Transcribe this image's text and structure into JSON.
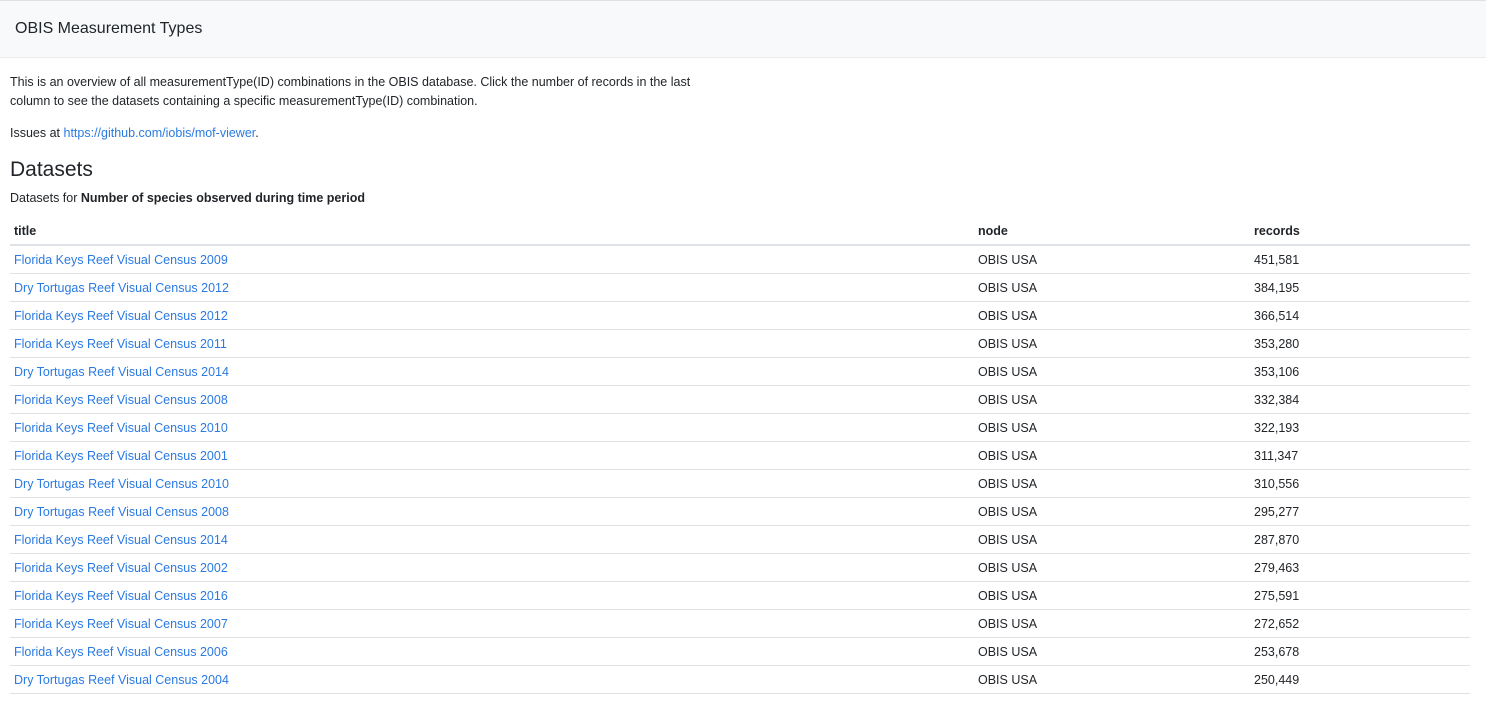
{
  "navbar": {
    "brand": "OBIS Measurement Types"
  },
  "intro": {
    "text": "This is an overview of all measurementType(ID) combinations in the OBIS database. Click the number of records in the last column to see the datasets containing a specific measurementType(ID) combination.",
    "issues_prefix": "Issues at ",
    "issues_link": "https://github.com/iobis/mof-viewer",
    "issues_suffix": "."
  },
  "datasets": {
    "heading": "Datasets",
    "subtitle_prefix": "Datasets for ",
    "subtitle_bold": "Number of species observed during time period",
    "columns": [
      "title",
      "node",
      "records"
    ],
    "rows": [
      {
        "title": "Florida Keys Reef Visual Census 2009",
        "node": "OBIS USA",
        "records": "451,581"
      },
      {
        "title": "Dry Tortugas Reef Visual Census 2012",
        "node": "OBIS USA",
        "records": "384,195"
      },
      {
        "title": "Florida Keys Reef Visual Census 2012",
        "node": "OBIS USA",
        "records": "366,514"
      },
      {
        "title": "Florida Keys Reef Visual Census 2011",
        "node": "OBIS USA",
        "records": "353,280"
      },
      {
        "title": "Dry Tortugas Reef Visual Census 2014",
        "node": "OBIS USA",
        "records": "353,106"
      },
      {
        "title": "Florida Keys Reef Visual Census 2008",
        "node": "OBIS USA",
        "records": "332,384"
      },
      {
        "title": "Florida Keys Reef Visual Census 2010",
        "node": "OBIS USA",
        "records": "322,193"
      },
      {
        "title": "Florida Keys Reef Visual Census 2001",
        "node": "OBIS USA",
        "records": "311,347"
      },
      {
        "title": "Dry Tortugas Reef Visual Census 2010",
        "node": "OBIS USA",
        "records": "310,556"
      },
      {
        "title": "Dry Tortugas Reef Visual Census 2008",
        "node": "OBIS USA",
        "records": "295,277"
      },
      {
        "title": "Florida Keys Reef Visual Census 2014",
        "node": "OBIS USA",
        "records": "287,870"
      },
      {
        "title": "Florida Keys Reef Visual Census 2002",
        "node": "OBIS USA",
        "records": "279,463"
      },
      {
        "title": "Florida Keys Reef Visual Census 2016",
        "node": "OBIS USA",
        "records": "275,591"
      },
      {
        "title": "Florida Keys Reef Visual Census 2007",
        "node": "OBIS USA",
        "records": "272,652"
      },
      {
        "title": "Florida Keys Reef Visual Census 2006",
        "node": "OBIS USA",
        "records": "253,678"
      },
      {
        "title": "Dry Tortugas Reef Visual Census 2004",
        "node": "OBIS USA",
        "records": "250,449"
      }
    ]
  },
  "colors": {
    "link": "#2a7ae2",
    "navbar_bg": "#f8f9fa",
    "text": "#212529"
  }
}
